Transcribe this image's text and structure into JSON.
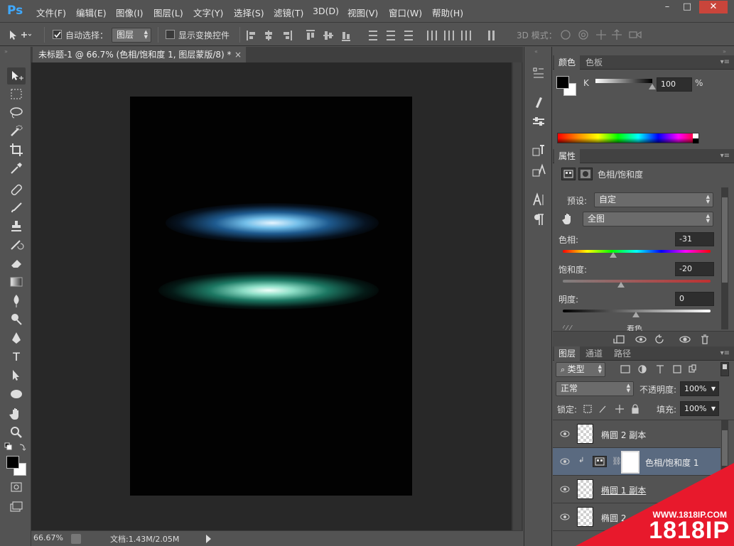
{
  "app": {
    "logo": "Ps"
  },
  "menu": [
    "文件(F)",
    "编辑(E)",
    "图像(I)",
    "图层(L)",
    "文字(Y)",
    "选择(S)",
    "滤镜(T)",
    "3D(D)",
    "视图(V)",
    "窗口(W)",
    "帮助(H)"
  ],
  "window_controls": {
    "minimize": "–",
    "restore": "□",
    "close": "✕"
  },
  "options": {
    "auto_select_label": "自动选择：",
    "auto_select_value": "图层",
    "show_transform_label": "显示变换控件",
    "mode_3d_label": "3D 模式："
  },
  "document": {
    "tab_title": "未标题-1 @ 66.7% (色相/饱和度 1, 图层蒙版/8) *",
    "tab_close": "×"
  },
  "status": {
    "zoom": "66.67%",
    "doc_size": "文档:1.43M/2.05M"
  },
  "color_panel": {
    "tabs": [
      "颜色",
      "色板"
    ],
    "channel_label": "K",
    "channel_value": "100",
    "unit": "%",
    "k_level": 1.0
  },
  "properties_panel": {
    "tab": "属性",
    "title": "色相/饱和度",
    "preset_label": "预设:",
    "preset_value": "自定",
    "range_value": "全图",
    "hue_label": "色相:",
    "hue_value": "-31",
    "sat_label": "饱和度:",
    "sat_value": "-20",
    "light_label": "明度:",
    "light_value": "0",
    "colorize_label": "着色"
  },
  "layers_panel": {
    "tabs": [
      "图层",
      "通道",
      "路径"
    ],
    "filter_label": "类型",
    "blend_mode": "正常",
    "opacity_label": "不透明度:",
    "opacity_value": "100%",
    "lock_label": "锁定:",
    "fill_label": "填充:",
    "fill_value": "100%",
    "layers": [
      {
        "name": "椭圆 2 副本",
        "selected": false
      },
      {
        "name": "色相/饱和度 1",
        "selected": true
      },
      {
        "name": "椭圆 1 副本",
        "selected": false
      },
      {
        "name": "椭圆 2",
        "selected": false
      }
    ]
  },
  "watermark": {
    "url": "WWW.1818IP.COM",
    "brand": "1818IP"
  },
  "colors": {
    "accent": "#3fa9ff",
    "bg": "#535353",
    "canvas_bg": "#282828",
    "selected_layer": "#5a6a80",
    "watermark_red": "#e8192c"
  }
}
